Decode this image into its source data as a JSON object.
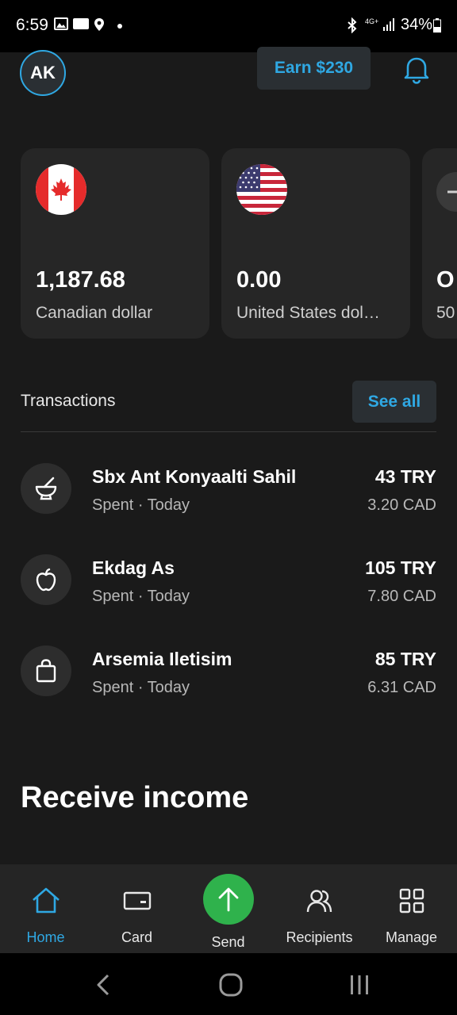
{
  "status_bar": {
    "time": "6:59",
    "network": "4G+",
    "battery": "34%"
  },
  "header": {
    "avatar_initials": "AK",
    "earn_label": "Earn $230"
  },
  "balances": [
    {
      "amount": "1,187.68",
      "currency": "Canadian dollar",
      "flag": "canada-flag"
    },
    {
      "amount": "0.00",
      "currency": "United States dol…",
      "flag": "us-flag"
    },
    {
      "amount": "O",
      "currency": "50",
      "flag": "add-icon"
    }
  ],
  "transactions": {
    "title": "Transactions",
    "see_all_label": "See all",
    "items": [
      {
        "icon": "mortar-pestle-icon",
        "name": "Sbx Ant Konyaalti Sahil",
        "status": "Spent · Today",
        "amount": "43 TRY",
        "converted": "3.20 CAD"
      },
      {
        "icon": "apple-icon",
        "name": "Ekdag As",
        "status": "Spent · Today",
        "amount": "105 TRY",
        "converted": "7.80 CAD"
      },
      {
        "icon": "shopping-bag-icon",
        "name": "Arsemia Iletisim",
        "status": "Spent · Today",
        "amount": "85 TRY",
        "converted": "6.31 CAD"
      }
    ]
  },
  "receive_income": {
    "title": "Receive income"
  },
  "bottom_nav": {
    "items": [
      {
        "label": "Home",
        "icon": "home-icon",
        "active": true
      },
      {
        "label": "Card",
        "icon": "card-icon",
        "active": false
      },
      {
        "label": "Send",
        "icon": "send-arrow-icon",
        "active": false
      },
      {
        "label": "Recipients",
        "icon": "recipients-icon",
        "active": false
      },
      {
        "label": "Manage",
        "icon": "grid-icon",
        "active": false
      }
    ]
  },
  "colors": {
    "accent": "#2fa8e3",
    "send_green": "#2fb24c",
    "background": "#1a1a1a",
    "card_bg": "#262626"
  }
}
